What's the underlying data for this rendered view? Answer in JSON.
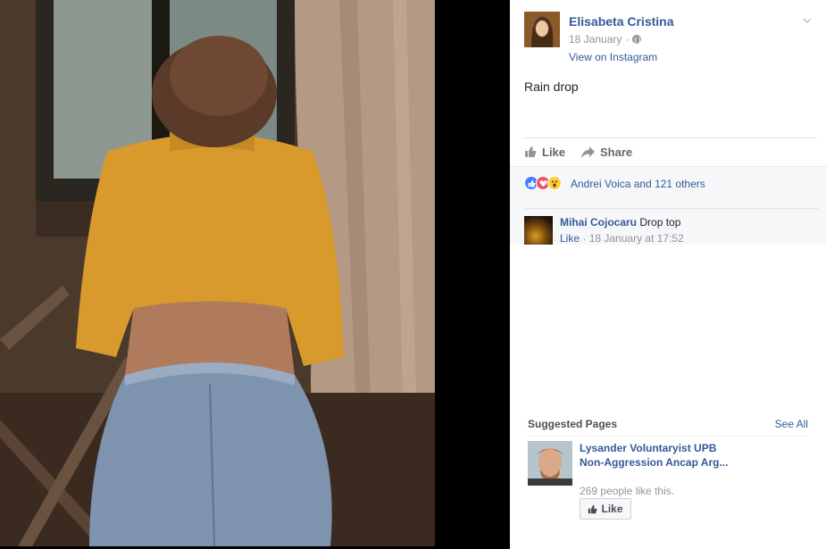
{
  "post": {
    "author": "Elisabeta Cristina",
    "date": "18 January",
    "meta_separator": "·",
    "view_link": "View on Instagram",
    "text": "Rain drop"
  },
  "actions": {
    "like": "Like",
    "share": "Share"
  },
  "reactions": {
    "types": [
      "like",
      "love",
      "wow"
    ],
    "summary": "Andrei Voica and 121 others"
  },
  "comment": {
    "author": "Mihai Cojocaru",
    "text": "Drop top",
    "like": "Like",
    "timestamp": "· 18 January at 17:52"
  },
  "suggested_pages": {
    "title": "Suggested Pages",
    "see_all": "See All",
    "page": {
      "name": "Lysander Voluntaryist UPB Non-Aggression Ancap Arg...",
      "likes": "269 people like this.",
      "like_button": "Like"
    }
  },
  "colors": {
    "link": "#365899",
    "text": "#1d2129",
    "muted": "#90949c",
    "panel_bg": "#ffffff",
    "feedback_bg": "#f6f7f9",
    "viewer_bg": "#000000"
  }
}
